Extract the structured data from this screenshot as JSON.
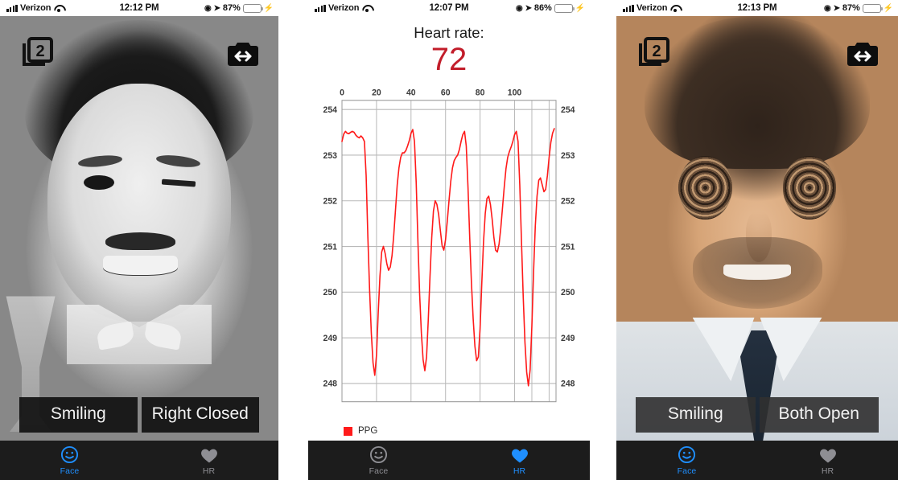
{
  "panels": [
    {
      "id": "face-panel-left",
      "status": {
        "carrier": "Verizon",
        "time": "12:12 PM",
        "battery_pct": "87%",
        "wifi_icon": "wifi-icon",
        "signal_icon": "signal-bars-icon",
        "location_icon": "location-arrow-icon",
        "alarm_icon": "alarm-clock-icon",
        "charging_icon": "lightning-bolt-icon"
      },
      "overlay": {
        "face_count": "2",
        "face_count_icon": "face-count-badge-icon",
        "camera_flip_icon": "camera-flip-icon"
      },
      "labels": [
        "Smiling",
        "Right Closed"
      ],
      "tabs": [
        {
          "label": "Face",
          "icon": "smiley-face-icon",
          "active": true
        },
        {
          "label": "HR",
          "icon": "heart-icon",
          "active": false
        }
      ]
    },
    {
      "id": "hr-panel-middle",
      "status": {
        "carrier": "Verizon",
        "time": "12:07 PM",
        "battery_pct": "86%",
        "wifi_icon": "wifi-icon",
        "signal_icon": "signal-bars-icon",
        "location_icon": "location-arrow-icon",
        "alarm_icon": "alarm-clock-icon",
        "charging_icon": "lightning-bolt-icon"
      },
      "heart_rate_title": "Heart rate:",
      "heart_rate_value": "72",
      "tabs": [
        {
          "label": "Face",
          "icon": "smiley-face-icon",
          "active": false
        },
        {
          "label": "HR",
          "icon": "heart-icon",
          "active": true
        }
      ]
    },
    {
      "id": "face-panel-right",
      "status": {
        "carrier": "Verizon",
        "time": "12:13 PM",
        "battery_pct": "87%",
        "wifi_icon": "wifi-icon",
        "signal_icon": "signal-bars-icon",
        "location_icon": "location-arrow-icon",
        "alarm_icon": "alarm-clock-icon",
        "charging_icon": "lightning-bolt-icon"
      },
      "overlay": {
        "face_count": "2",
        "face_count_icon": "face-count-badge-icon",
        "camera_flip_icon": "camera-flip-icon"
      },
      "labels": [
        "Smiling",
        "Both Open"
      ],
      "tabs": [
        {
          "label": "Face",
          "icon": "smiley-face-icon",
          "active": true
        },
        {
          "label": "HR",
          "icon": "heart-icon",
          "active": false
        }
      ]
    }
  ],
  "colors": {
    "accent_blue": "#1f8fff",
    "ppg_red": "#ff1a1a",
    "hr_value_red": "#c21d2a",
    "tabbar_bg": "#1c1c1c",
    "inactive_gray": "#8e8e93",
    "battery_green": "#4cd964"
  },
  "chart_data": {
    "type": "line",
    "title": "Heart rate:",
    "xlabel": "",
    "ylabel": "",
    "xlim": [
      0,
      124
    ],
    "ylim": [
      247.6,
      254.2
    ],
    "xticks": [
      0,
      20,
      40,
      60,
      80,
      100
    ],
    "yticks": [
      248,
      249,
      250,
      251,
      252,
      253,
      254
    ],
    "xtick_labels": [
      "0",
      "20",
      "40",
      "60",
      "80",
      "100"
    ],
    "ytick_labels_left": [
      "254",
      "253",
      "252",
      "251",
      "250",
      "249",
      "248"
    ],
    "ytick_labels_right": [
      "254",
      "253",
      "252",
      "251",
      "250",
      "249",
      "248"
    ],
    "grid": true,
    "x_axis_position": "top",
    "dual_y_axis": true,
    "legend": {
      "position": "bottom-left",
      "entries": [
        {
          "name": "PPG",
          "color": "#ff1a1a"
        }
      ]
    },
    "series": [
      {
        "name": "PPG",
        "color": "#ff1a1a",
        "x": [
          0,
          1,
          2,
          3,
          4,
          5,
          6,
          7,
          8,
          9,
          10,
          11,
          12,
          13,
          14,
          15,
          16,
          17,
          18,
          19,
          20,
          21,
          22,
          23,
          24,
          25,
          26,
          27,
          28,
          29,
          30,
          31,
          32,
          33,
          34,
          35,
          36,
          37,
          38,
          39,
          40,
          41,
          42,
          43,
          44,
          45,
          46,
          47,
          48,
          49,
          50,
          51,
          52,
          53,
          54,
          55,
          56,
          57,
          58,
          59,
          60,
          61,
          62,
          63,
          64,
          65,
          66,
          67,
          68,
          69,
          70,
          71,
          72,
          73,
          74,
          75,
          76,
          77,
          78,
          79,
          80,
          81,
          82,
          83,
          84,
          85,
          86,
          87,
          88,
          89,
          90,
          91,
          92,
          93,
          94,
          95,
          96,
          97,
          98,
          99,
          100,
          101,
          102,
          103,
          104,
          105,
          106,
          107,
          108,
          109,
          110,
          111,
          112,
          113,
          114,
          115,
          116,
          117,
          118,
          119,
          120,
          121,
          122,
          123
        ],
        "y": [
          253.3,
          253.46,
          253.52,
          253.48,
          253.47,
          253.5,
          253.52,
          253.5,
          253.44,
          253.4,
          253.38,
          253.42,
          253.38,
          253.3,
          252.55,
          251.2,
          250.05,
          249.1,
          248.45,
          248.18,
          248.62,
          249.55,
          250.35,
          250.88,
          251.0,
          250.85,
          250.62,
          250.48,
          250.55,
          250.8,
          251.25,
          251.8,
          252.35,
          252.72,
          252.95,
          253.05,
          253.05,
          253.1,
          253.2,
          253.32,
          253.48,
          253.56,
          253.3,
          252.4,
          251.1,
          249.95,
          249.1,
          248.52,
          248.28,
          248.58,
          249.4,
          250.35,
          251.2,
          251.78,
          252.0,
          251.92,
          251.7,
          251.35,
          251.02,
          250.92,
          251.15,
          251.55,
          252.0,
          252.42,
          252.72,
          252.88,
          252.95,
          253.0,
          253.12,
          253.3,
          253.45,
          253.52,
          253.2,
          252.3,
          251.2,
          250.2,
          249.42,
          248.82,
          248.5,
          248.58,
          249.2,
          250.2,
          251.1,
          251.72,
          252.05,
          252.1,
          251.92,
          251.6,
          251.2,
          250.92,
          250.88,
          251.05,
          251.4,
          251.85,
          252.3,
          252.7,
          252.95,
          253.08,
          253.18,
          253.3,
          253.45,
          253.52,
          253.3,
          252.35,
          251.1,
          249.9,
          248.9,
          248.25,
          247.95,
          248.3,
          249.25,
          250.45,
          251.45,
          252.1,
          252.45,
          252.5,
          252.35,
          252.2,
          252.25,
          252.55,
          252.95,
          253.28,
          253.48,
          253.58,
          253.6,
          253.55
        ]
      }
    ]
  }
}
